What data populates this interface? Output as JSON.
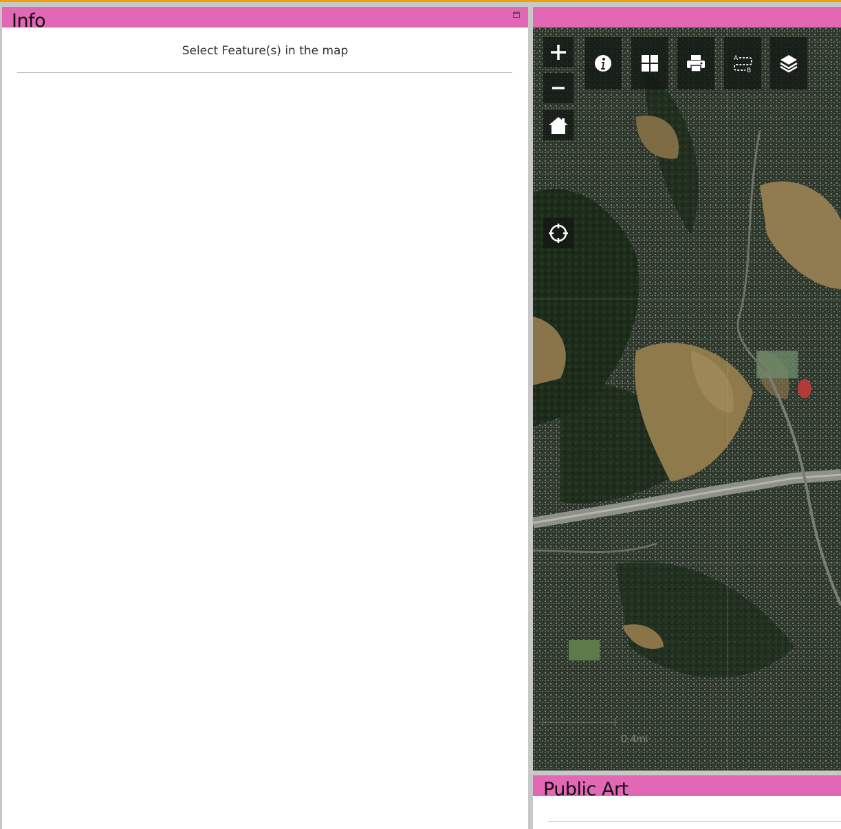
{
  "info_panel": {
    "title": "Info",
    "message": "Select Feature(s) in the map"
  },
  "map_panel": {
    "scale_label": "0.4mi",
    "tools": {
      "zoom_in": "plus-icon",
      "zoom_out": "minus-icon",
      "home": "home-icon",
      "locate": "crosshair-icon",
      "info": "info-icon",
      "basemap": "grid-icon",
      "print": "printer-icon",
      "measure": "a-b-icon",
      "layers": "layers-icon"
    }
  },
  "public_art_panel": {
    "title": "Public Art"
  },
  "colors": {
    "header": "#e267b5",
    "accent_line": "#f0a000",
    "frame": "#c8c8c8"
  }
}
